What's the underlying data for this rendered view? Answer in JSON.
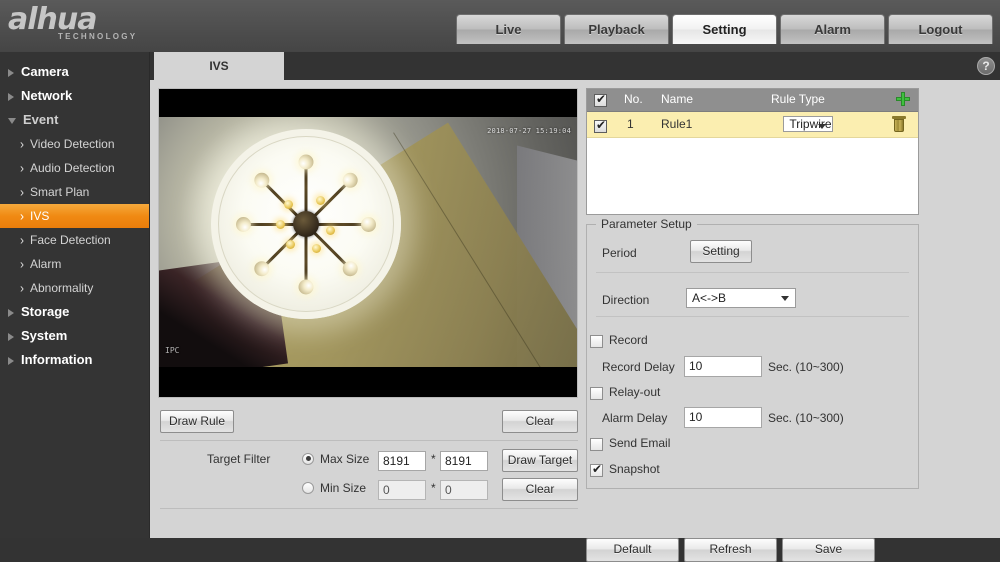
{
  "header": {
    "logo_main": "alhua",
    "logo_sub": "TECHNOLOGY",
    "nav": [
      {
        "label": "Live",
        "active": false
      },
      {
        "label": "Playback",
        "active": false
      },
      {
        "label": "Setting",
        "active": true
      },
      {
        "label": "Alarm",
        "active": false
      },
      {
        "label": "Logout",
        "active": false
      }
    ]
  },
  "sidebar": {
    "items": [
      {
        "label": "Camera",
        "type": "top",
        "state": "collapsed"
      },
      {
        "label": "Network",
        "type": "top",
        "state": "collapsed"
      },
      {
        "label": "Event",
        "type": "top",
        "state": "expanded"
      },
      {
        "label": "Video Detection",
        "type": "sub",
        "selected": false
      },
      {
        "label": "Audio Detection",
        "type": "sub",
        "selected": false
      },
      {
        "label": "Smart Plan",
        "type": "sub",
        "selected": false
      },
      {
        "label": "IVS",
        "type": "sub",
        "selected": true
      },
      {
        "label": "Face Detection",
        "type": "sub",
        "selected": false
      },
      {
        "label": "Alarm",
        "type": "sub",
        "selected": false
      },
      {
        "label": "Abnormality",
        "type": "sub",
        "selected": false
      },
      {
        "label": "Storage",
        "type": "top",
        "state": "collapsed"
      },
      {
        "label": "System",
        "type": "top",
        "state": "collapsed"
      },
      {
        "label": "Information",
        "type": "top",
        "state": "collapsed"
      }
    ]
  },
  "content": {
    "tab_label": "IVS",
    "help_label": "?"
  },
  "video": {
    "timestamp": "2018-07-27 15:19:04",
    "watermark": "IPC"
  },
  "draw": {
    "draw_rule_label": "Draw Rule",
    "clear_top_label": "Clear",
    "target_filter_label": "Target Filter",
    "max_size_label": "Max Size",
    "min_size_label": "Min Size",
    "max_width": "8191",
    "max_height": "8191",
    "min_width": "0",
    "min_height": "0",
    "multiply_symbol": "*",
    "draw_target_label": "Draw Target",
    "clear_bottom_label": "Clear",
    "max_selected": true,
    "min_selected": false
  },
  "rules": {
    "columns": {
      "no": "No.",
      "name": "Name",
      "rule_type": "Rule Type"
    },
    "header_checked": true,
    "add_icon": "plus-icon",
    "rows": [
      {
        "checked": true,
        "no": "1",
        "name": "Rule1",
        "rule_type": "Tripwire",
        "delete_icon": "trash-icon"
      }
    ]
  },
  "parameter_setup": {
    "title": "Parameter Setup",
    "period_label": "Period",
    "period_button": "Setting",
    "direction_label": "Direction",
    "direction_value": "A<->B",
    "record_label": "Record",
    "record_checked": false,
    "record_delay_label": "Record Delay",
    "record_delay_value": "10",
    "record_delay_unit": "Sec. (10~300)",
    "relay_out_label": "Relay-out",
    "relay_out_checked": false,
    "alarm_delay_label": "Alarm Delay",
    "alarm_delay_value": "10",
    "alarm_delay_unit": "Sec. (10~300)",
    "send_email_label": "Send Email",
    "send_email_checked": false,
    "snapshot_label": "Snapshot",
    "snapshot_checked": true
  },
  "footer": {
    "default_label": "Default",
    "refresh_label": "Refresh",
    "save_label": "Save"
  },
  "colors": {
    "accent_orange": "#f08a13",
    "header_dark": "#4e4e4e",
    "panel_gray": "#d4d4d4",
    "row_highlight": "#fbeeb0",
    "add_green": "#3fc03f"
  }
}
